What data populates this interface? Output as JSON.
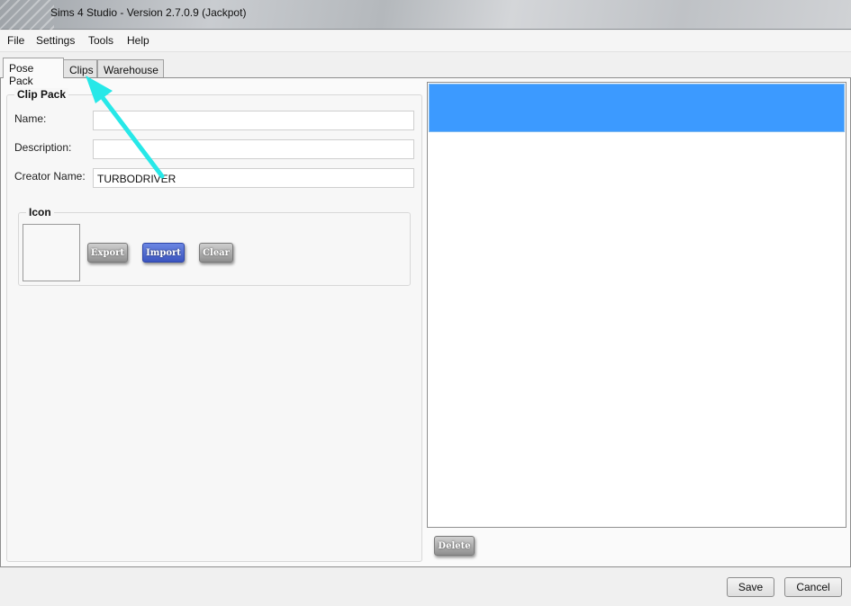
{
  "window": {
    "title": "Sims 4 Studio - Version 2.7.0.9  (Jackpot)"
  },
  "menu": {
    "items": [
      "File",
      "Settings",
      "Tools",
      "Help"
    ]
  },
  "tabs": [
    {
      "label": "Pose Pack",
      "active": true
    },
    {
      "label": "Clips",
      "active": false
    },
    {
      "label": "Warehouse",
      "active": false
    }
  ],
  "clip_pack": {
    "title": "Clip Pack",
    "name_label": "Name:",
    "name_value": "",
    "description_label": "Description:",
    "description_value": "",
    "creator_label": "Creator Name:",
    "creator_value": "TURBODRIVER"
  },
  "icon_group": {
    "title": "Icon",
    "export_label": "Export",
    "import_label": "Import",
    "clear_label": "Clear"
  },
  "list_panel": {
    "delete_label": "Delete"
  },
  "footer": {
    "save_label": "Save",
    "cancel_label": "Cancel"
  },
  "colors": {
    "selection": "#3c9aff",
    "annotation_arrow": "#27e8e8",
    "import_button": "#4a66d0"
  },
  "annotation": {
    "type": "arrow",
    "points_to": "tab-clips"
  }
}
